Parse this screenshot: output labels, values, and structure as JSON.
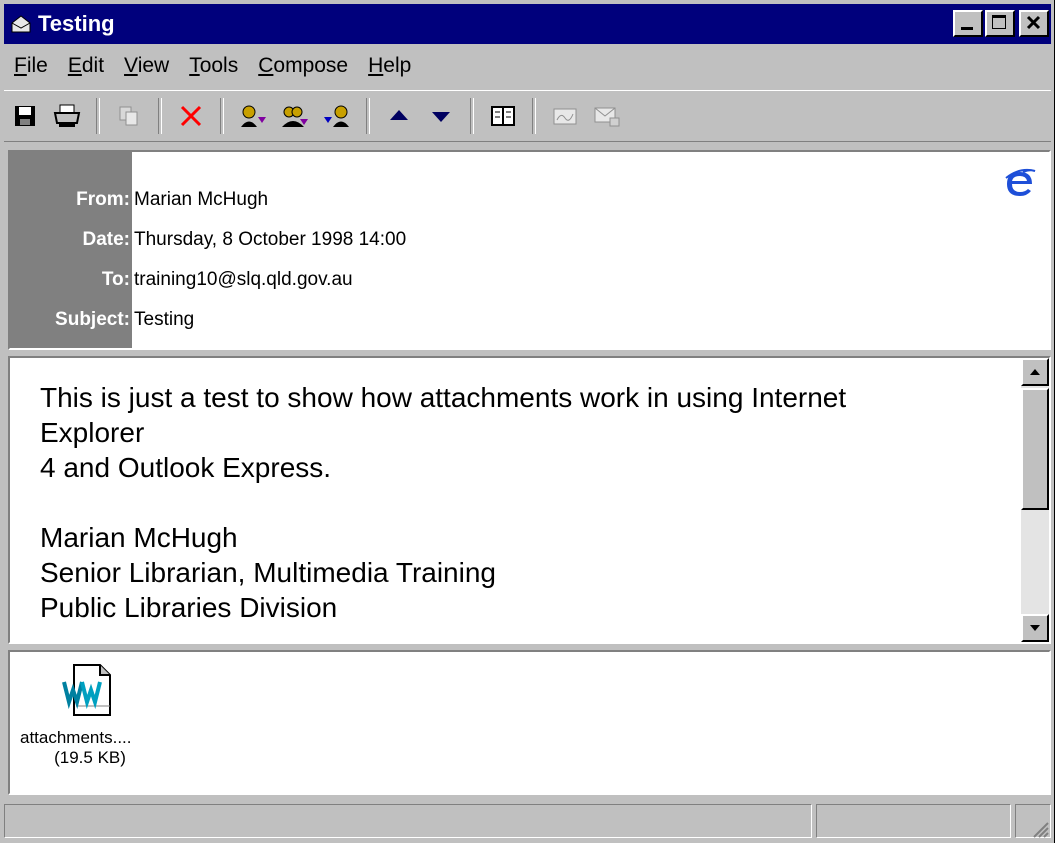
{
  "window": {
    "title": "Testing",
    "controls": [
      "minimize",
      "maximize",
      "close"
    ]
  },
  "menu": [
    {
      "label": "File",
      "accel": "F",
      "rest": "ile"
    },
    {
      "label": "Edit",
      "accel": "E",
      "rest": "dit"
    },
    {
      "label": "View",
      "accel": "V",
      "rest": "iew"
    },
    {
      "label": "Tools",
      "accel": "T",
      "rest": "ools"
    },
    {
      "label": "Compose",
      "accel": "C",
      "rest": "ompose"
    },
    {
      "label": "Help",
      "accel": "H",
      "rest": "elp"
    }
  ],
  "toolbar": {
    "buttons": [
      "save-icon",
      "print-icon",
      "copy-icon",
      "delete-icon",
      "reply-icon",
      "reply-all-icon",
      "forward-icon",
      "previous-icon",
      "next-icon",
      "address-book-icon",
      "sign-icon",
      "encrypt-icon"
    ]
  },
  "header": {
    "from_label": "From:",
    "from": "Marian McHugh",
    "date_label": "Date:",
    "date": "Thursday, 8 October 1998 14:00",
    "to_label": "To:",
    "to": "training10@slq.qld.gov.au",
    "subject_label": "Subject:",
    "subject": "Testing"
  },
  "body": {
    "lines": [
      "This is just a test to show how attachments work in using Internet",
      "Explorer",
      "4 and Outlook Express.",
      "",
      "Marian McHugh",
      "Senior Librarian, Multimedia Training",
      "Public Libraries Division"
    ]
  },
  "attachments": [
    {
      "name": "attachments....",
      "size": "(19.5 KB)",
      "icon": "word-document-icon"
    }
  ],
  "colors": {
    "titlebar": "#00007c",
    "face": "#c0c0c0",
    "header_labels_bg": "#808080",
    "delete_red": "#ff0000",
    "ie_blue": "#1e4fd8"
  }
}
